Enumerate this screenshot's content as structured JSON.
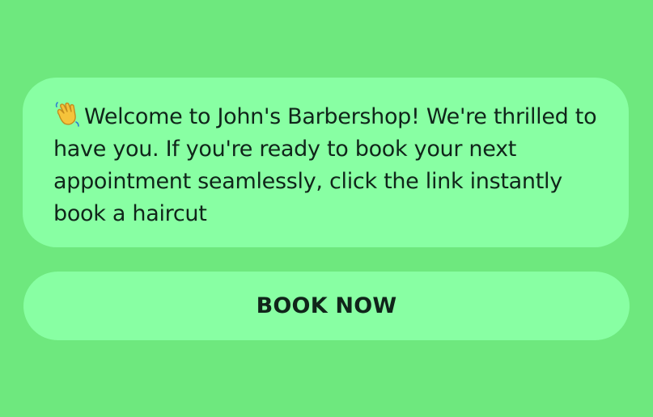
{
  "message": {
    "icon": "waving-hand-icon",
    "text": "Welcome to John's Barbershop! We're thrilled to have you. If you're ready to book your next appointment seamlessly, click the link instantly book a haircut"
  },
  "action": {
    "button_label": "BOOK NOW"
  },
  "colors": {
    "background": "#6ee87e",
    "bubble": "#88ffa3",
    "text": "#10251a"
  }
}
